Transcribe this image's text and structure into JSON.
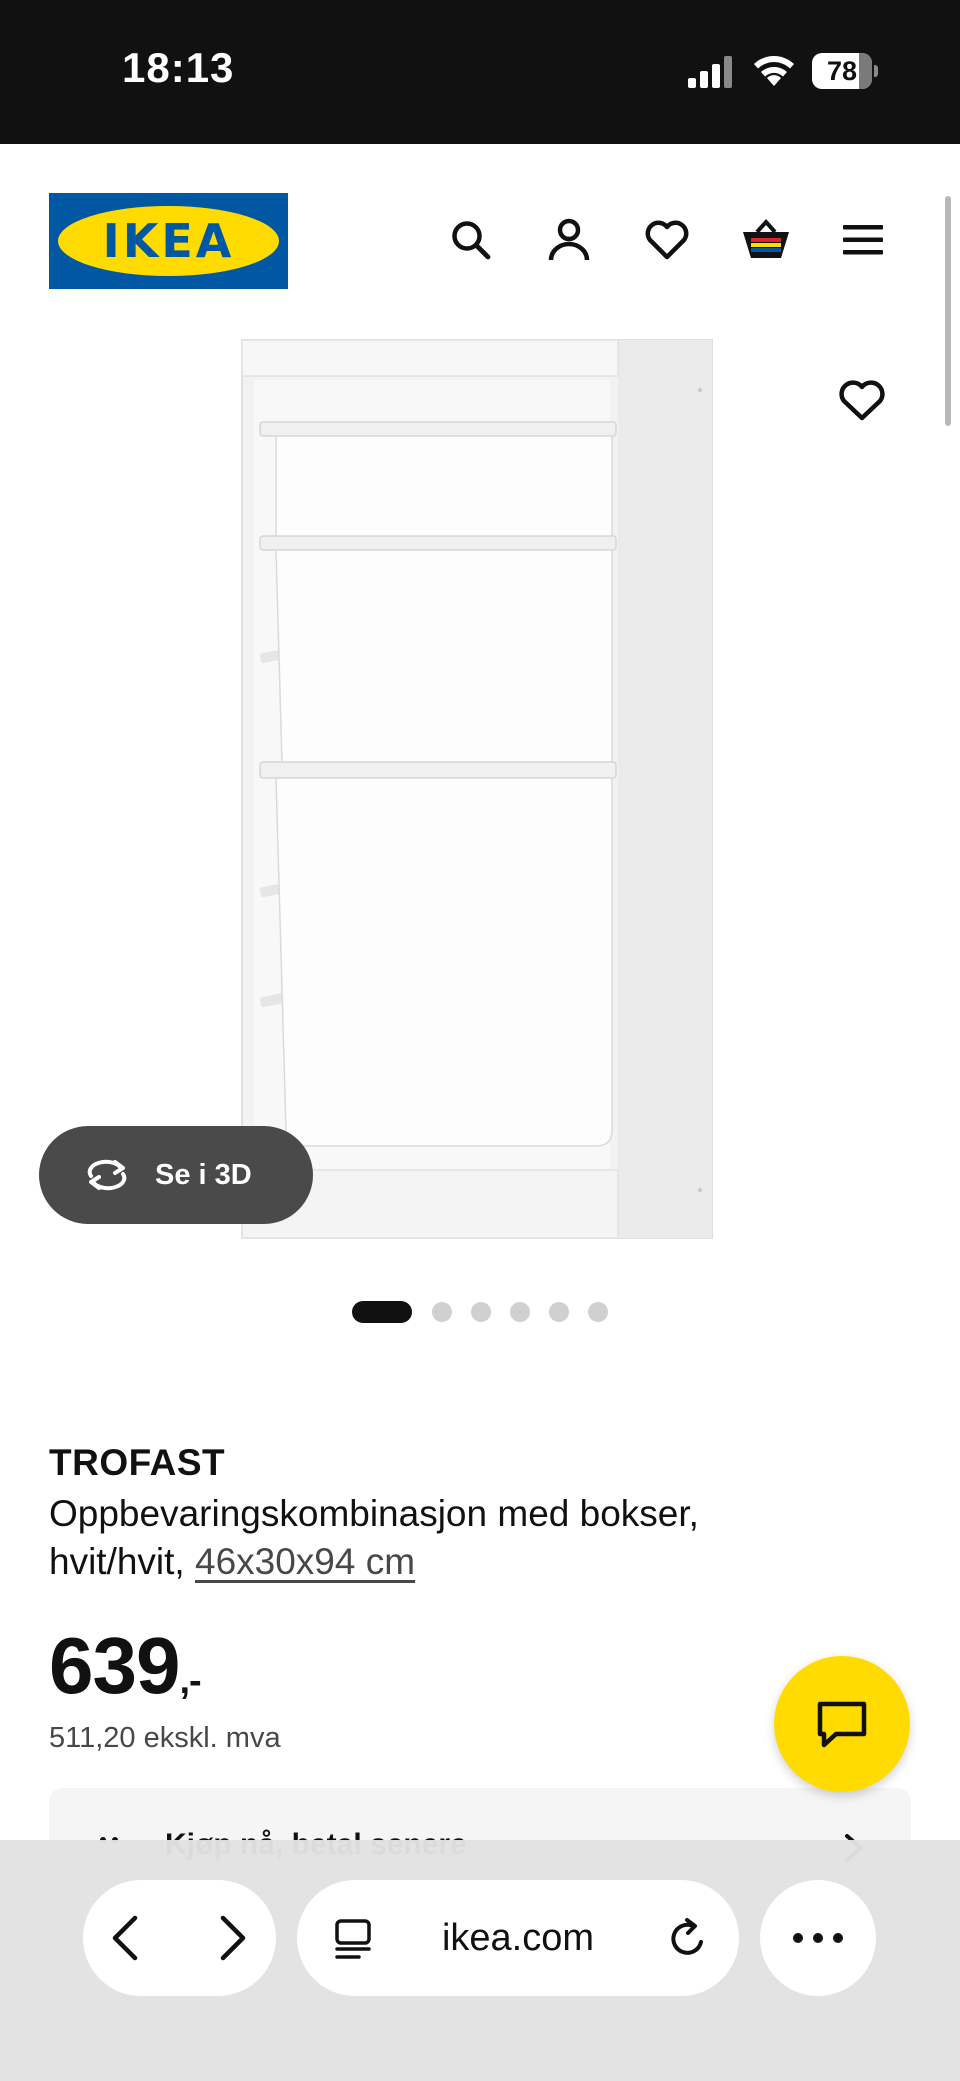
{
  "status_bar": {
    "time": "18:13",
    "battery_level": "78"
  },
  "header": {
    "logo_text": "IKEA",
    "icons": [
      "search-icon",
      "profile-icon",
      "favorites-icon",
      "shopping-bag-icon",
      "menu-icon"
    ]
  },
  "gallery": {
    "see_3d_label": "Se i 3D",
    "slide_count": 6,
    "active_slide": 1
  },
  "product": {
    "name": "TROFAST",
    "description": "Oppbevaringskombinasjon med bokser, hvit/hvit, ",
    "measurements": "46x30x94 cm",
    "price_main": "639",
    "price_suffix": ",-",
    "price_excl_vat": "511,20 ekskl. mva"
  },
  "info_card": {
    "label": "Kjøp nå, betal senere"
  },
  "browser": {
    "url": "ikea.com"
  },
  "colors": {
    "ikea_blue": "#0058a3",
    "ikea_yellow": "#ffdb00",
    "status_bar_bg": "#111111",
    "pill_dark": "#4a4a4a"
  }
}
